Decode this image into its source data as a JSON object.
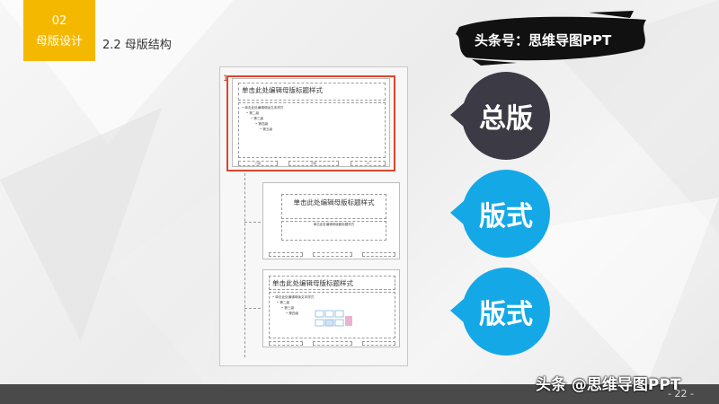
{
  "section": {
    "number": "02",
    "title": "母版设计"
  },
  "subsection": "2.2 母版结构",
  "brand": "头条号：思维导图PPT",
  "master_panel": {
    "slide_index": "1",
    "master_thumb": {
      "title": "单击此处编辑母版标题样式",
      "bullets": [
        "• 单击此处编辑母版文本样式",
        "• 第二级",
        "• 第三级",
        "• 第四级",
        "• 第五级"
      ],
      "footers": [
        "日期",
        "页脚",
        "‹#›"
      ]
    },
    "layout_thumb_1": {
      "title": "单击此处编辑母版标题样式",
      "subtitle": "单击此处编辑母版副标题样式"
    },
    "layout_thumb_2": {
      "title": "单击此处编辑母版标题样式",
      "bullets": [
        "• 单击此处编辑母版文本样式",
        "• 第二级",
        "• 第三级",
        "• 第四级"
      ]
    }
  },
  "labels": {
    "master": "总版",
    "layout_1": "版式",
    "layout_2": "版式"
  },
  "colors": {
    "badge": "#f5b800",
    "dark_circle": "#3c3b45",
    "blue_circle": "#15a8e6",
    "highlight": "#d9472b"
  },
  "footer": {
    "page": "- 22 -"
  },
  "watermark": "头条 @思维导图PPT"
}
